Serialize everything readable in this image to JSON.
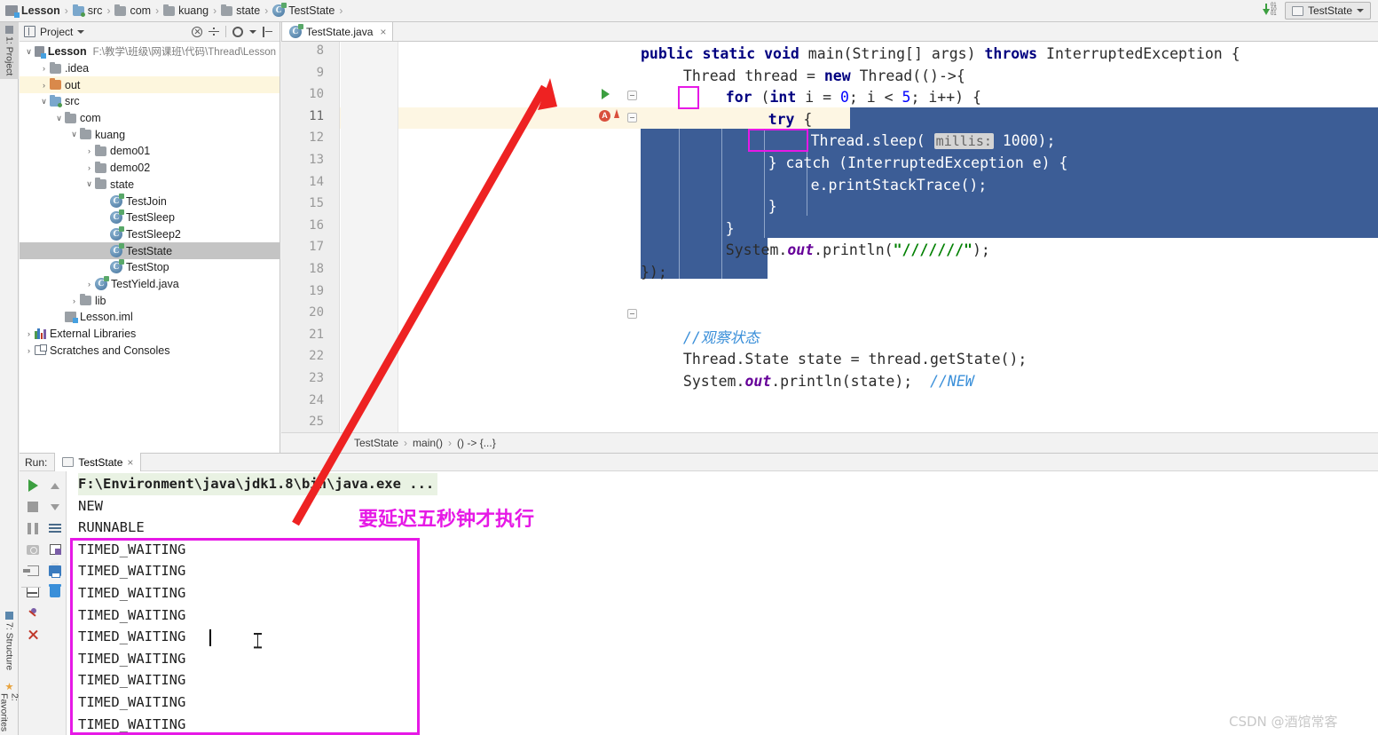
{
  "window": {
    "breadcrumb": [
      {
        "label": "Lesson",
        "icon": "module-icon",
        "bold": true
      },
      {
        "label": "src",
        "icon": "folder-src-icon",
        "bold": false
      },
      {
        "label": "com",
        "icon": "folder-icon",
        "bold": false
      },
      {
        "label": "kuang",
        "icon": "folder-icon",
        "bold": false
      },
      {
        "label": "state",
        "icon": "folder-icon",
        "bold": false
      },
      {
        "label": "TestState",
        "icon": "class-icon",
        "bold": false
      }
    ],
    "separator": "›",
    "sort_icon": "sort-numeric-icon",
    "run_config": {
      "label": "TestState",
      "icon": "run-config-icon",
      "caret": "chevron-down-icon"
    }
  },
  "left_strip": {
    "tabs": [
      {
        "label": "1: Project",
        "icon": "project-icon",
        "selected": true
      },
      {
        "label": "7: Structure",
        "icon": "structure-icon",
        "selected": false
      },
      {
        "label": "2: Favorites",
        "icon": "favorites-star-icon",
        "selected": false
      }
    ]
  },
  "project_panel": {
    "title": "Project",
    "title_caret": "chevron-down-icon",
    "toolbar_icons": [
      "locate-icon",
      "collapse-divider-icon",
      "settings-gear-icon",
      "hide-panel-icon"
    ],
    "tree": [
      {
        "indent": 0,
        "arrow": "∨",
        "icon": "module-icon",
        "label": "Lesson",
        "sub": "F:\\教学\\班级\\网课班\\代码\\Thread\\Lesson",
        "bold": true,
        "state": ""
      },
      {
        "indent": 1,
        "arrow": "›",
        "icon": "folder-icon",
        "label": ".idea",
        "sub": "",
        "bold": false,
        "state": ""
      },
      {
        "indent": 1,
        "arrow": "›",
        "icon": "folder-out-icon",
        "label": "out",
        "sub": "",
        "bold": false,
        "state": "highlight"
      },
      {
        "indent": 1,
        "arrow": "∨",
        "icon": "folder-src-icon",
        "label": "src",
        "sub": "",
        "bold": false,
        "state": ""
      },
      {
        "indent": 2,
        "arrow": "∨",
        "icon": "folder-icon",
        "label": "com",
        "sub": "",
        "bold": false,
        "state": ""
      },
      {
        "indent": 3,
        "arrow": "∨",
        "icon": "folder-icon",
        "label": "kuang",
        "sub": "",
        "bold": false,
        "state": ""
      },
      {
        "indent": 4,
        "arrow": "›",
        "icon": "folder-icon",
        "label": "demo01",
        "sub": "",
        "bold": false,
        "state": ""
      },
      {
        "indent": 4,
        "arrow": "›",
        "icon": "folder-icon",
        "label": "demo02",
        "sub": "",
        "bold": false,
        "state": ""
      },
      {
        "indent": 4,
        "arrow": "∨",
        "icon": "folder-icon",
        "label": "state",
        "sub": "",
        "bold": false,
        "state": ""
      },
      {
        "indent": 5,
        "arrow": "",
        "icon": "class-icon",
        "label": "TestJoin",
        "sub": "",
        "bold": false,
        "state": ""
      },
      {
        "indent": 5,
        "arrow": "",
        "icon": "class-icon",
        "label": "TestSleep",
        "sub": "",
        "bold": false,
        "state": ""
      },
      {
        "indent": 5,
        "arrow": "",
        "icon": "class-icon",
        "label": "TestSleep2",
        "sub": "",
        "bold": false,
        "state": ""
      },
      {
        "indent": 5,
        "arrow": "",
        "icon": "class-icon",
        "label": "TestState",
        "sub": "",
        "bold": false,
        "state": "selected"
      },
      {
        "indent": 5,
        "arrow": "",
        "icon": "class-icon",
        "label": "TestStop",
        "sub": "",
        "bold": false,
        "state": ""
      },
      {
        "indent": 4,
        "arrow": "›",
        "icon": "class-icon",
        "label": "TestYield.java",
        "sub": "",
        "bold": false,
        "state": ""
      },
      {
        "indent": 3,
        "arrow": "›",
        "icon": "folder-icon",
        "label": "lib",
        "sub": "",
        "bold": false,
        "state": ""
      },
      {
        "indent": 2,
        "arrow": "",
        "icon": "iml-icon",
        "label": "Lesson.iml",
        "sub": "",
        "bold": false,
        "state": ""
      },
      {
        "indent": 0,
        "arrow": "›",
        "icon": "external-libraries-icon",
        "label": "External Libraries",
        "sub": "",
        "bold": false,
        "state": ""
      },
      {
        "indent": 0,
        "arrow": "›",
        "icon": "scratches-icon",
        "label": "Scratches and Consoles",
        "sub": "",
        "bold": false,
        "state": ""
      }
    ]
  },
  "editor": {
    "tab": {
      "label": "TestState.java",
      "icon": "class-icon",
      "close": "×"
    },
    "first_line_number": 8,
    "current_line": 11,
    "lines": [
      {
        "n": 8,
        "indent": 2,
        "text": "public static void main(String[] args) throws InterruptedException {"
      },
      {
        "n": 9,
        "indent": 3,
        "text": "Thread thread = new Thread(()->{"
      },
      {
        "n": 10,
        "indent": 4,
        "text": "for (int i = 0; i < 5; i++) {"
      },
      {
        "n": 11,
        "indent": 5,
        "text": "try {"
      },
      {
        "n": 12,
        "indent": 6,
        "text": "Thread.sleep( millis: 1000);"
      },
      {
        "n": 13,
        "indent": 5,
        "text": "} catch (InterruptedException e) {"
      },
      {
        "n": 14,
        "indent": 6,
        "text": "e.printStackTrace();"
      },
      {
        "n": 15,
        "indent": 5,
        "text": "}"
      },
      {
        "n": 16,
        "indent": 4,
        "text": "}"
      },
      {
        "n": 17,
        "indent": 4,
        "text": "System.out.println(\"///////\");"
      },
      {
        "n": 18,
        "indent": 2,
        "text": "});"
      },
      {
        "n": 19,
        "indent": 0,
        "text": ""
      },
      {
        "n": 20,
        "indent": 0,
        "text": ""
      },
      {
        "n": 21,
        "indent": 3,
        "text": "//观察状态"
      },
      {
        "n": 22,
        "indent": 3,
        "text": "Thread.State state = thread.getState();"
      },
      {
        "n": 23,
        "indent": 3,
        "text": "System.out.println(state);  //NEW"
      },
      {
        "n": 24,
        "indent": 0,
        "text": ""
      },
      {
        "n": 25,
        "indent": 0,
        "text": ""
      }
    ],
    "gutter_icons": [
      {
        "line": 8,
        "icon": "run-gutter-icon"
      },
      {
        "line": 9,
        "icon": "inspection-warning-icon"
      }
    ],
    "param_hint": "millis:",
    "status_breadcrumb": [
      "TestState",
      "main()",
      "() -> {...}"
    ],
    "status_separator": "›"
  },
  "run_panel": {
    "label": "Run:",
    "tab": {
      "label": "TestState",
      "icon": "run-tab-icon",
      "close": "×"
    },
    "toolbar_left": [
      "rerun-icon",
      "stop-icon",
      "pause-icon",
      "camera-icon",
      "export-icon",
      "layout-icon",
      "pin-icon",
      "close-icon"
    ],
    "toolbar_right": [
      "scroll-up-icon",
      "scroll-down-icon",
      "soft-wrap-icon",
      "scroll-to-end-icon",
      "print-icon",
      "clear-all-icon"
    ],
    "console_lines": [
      {
        "text": "F:\\Environment\\java\\jdk1.8\\bin\\java.exe ...",
        "style": "command"
      },
      {
        "text": "NEW",
        "style": "normal"
      },
      {
        "text": "RUNNABLE",
        "style": "normal"
      },
      {
        "text": "TIMED_WAITING",
        "style": "normal"
      },
      {
        "text": "TIMED_WAITING",
        "style": "normal"
      },
      {
        "text": "TIMED_WAITING",
        "style": "normal"
      },
      {
        "text": "TIMED_WAITING",
        "style": "normal"
      },
      {
        "text": "TIMED_WAITING",
        "style": "normal"
      },
      {
        "text": "TIMED_WAITING",
        "style": "normal"
      },
      {
        "text": "TIMED_WAITING",
        "style": "normal"
      },
      {
        "text": "TIMED_WAITING",
        "style": "normal"
      },
      {
        "text": "TIMED_WAITING",
        "style": "normal"
      }
    ]
  },
  "annotations": {
    "color": "#e619e6",
    "arrow_color": "#ee2222",
    "note_text": "要延迟五秒钟才执行",
    "boxes": [
      {
        "name": "loop-count-box",
        "target": "5"
      },
      {
        "name": "sleep-millis-box",
        "target": "1000)"
      },
      {
        "name": "console-timed-waiting-box",
        "target": "TIMED_WAITING block"
      }
    ]
  },
  "watermark": {
    "text": "CSDN @酒馆常客"
  }
}
